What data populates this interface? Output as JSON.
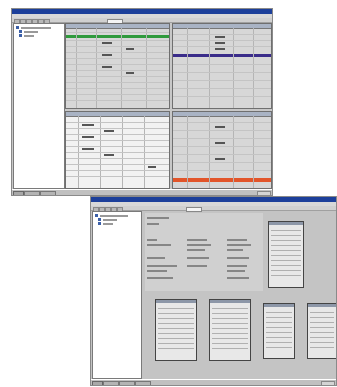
{
  "screenshots": [
    {
      "name": "top-screenshot",
      "panels": 4
    },
    {
      "name": "bottom-screenshot",
      "panels": 6
    }
  ],
  "colors": {
    "titlebar": "#1c3f9a",
    "green_band": "#2f9a3c",
    "purple_band": "#3a2c8a",
    "red_band": "#e2552a",
    "window_bg": "#c8c8c8"
  },
  "icons": [
    "folder-icon",
    "table-icon",
    "start-icon"
  ]
}
